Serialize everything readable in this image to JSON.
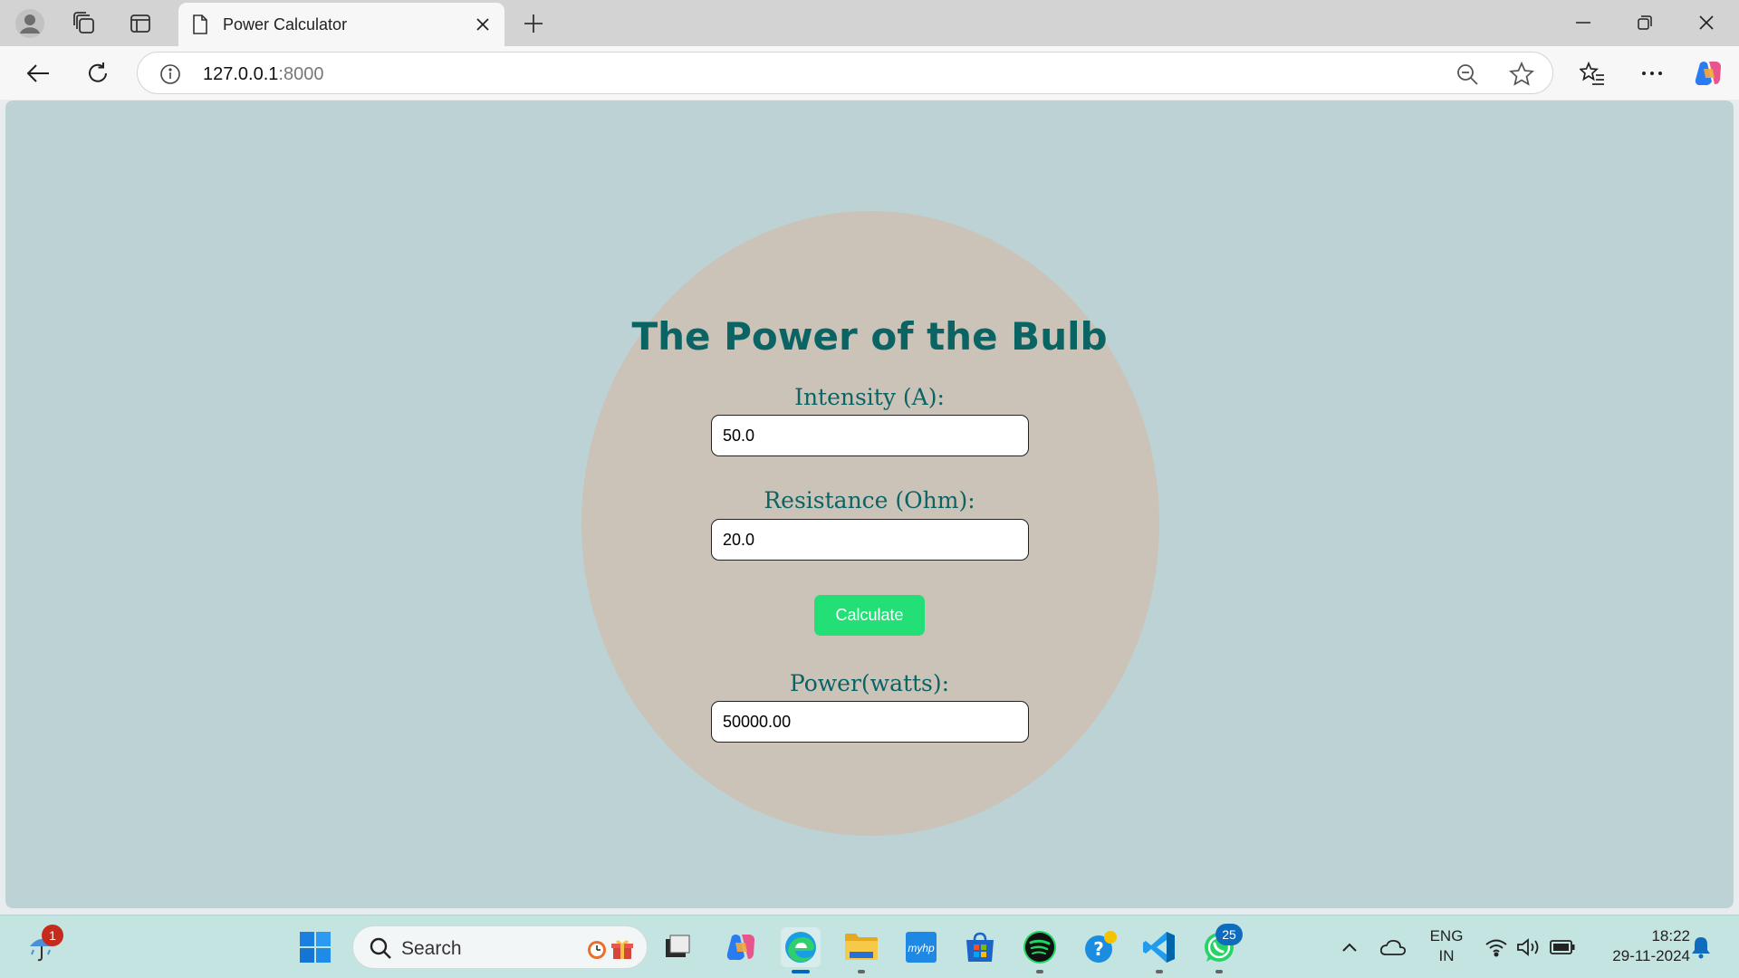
{
  "browser": {
    "tab_title": "Power Calculator",
    "url_host": "127.0.0.1",
    "url_port": ":8000"
  },
  "page": {
    "title": "The Power of the Bulb",
    "intensity_label": "Intensity (A):",
    "intensity_value": "50.0",
    "resistance_label": "Resistance (Ohm):",
    "resistance_value": "20.0",
    "calculate_label": "Calculate",
    "power_label": "Power(watts):",
    "power_value": "50000.00"
  },
  "taskbar": {
    "search_placeholder": "Search",
    "weather_badge": "1",
    "whatsapp_badge": "25",
    "language_line1": "ENG",
    "language_line2": "IN",
    "time": "18:22",
    "date": "29-11-2024"
  },
  "colors": {
    "page_bg": "#bdd2d4",
    "circle": "#cbc2b8",
    "heading": "#0b6464",
    "button": "#22e076",
    "taskbar": "#c4e4e2"
  }
}
